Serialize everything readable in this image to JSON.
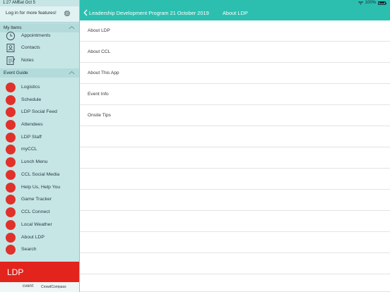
{
  "status_bar": {
    "time": "1:27 AM",
    "date": "Sat Oct 5",
    "battery": "100%"
  },
  "sidebar": {
    "login_label": "Log in for more features!",
    "my_items_header": "My Items",
    "my_items": [
      {
        "label": "Appointments",
        "icon": "clock-icon"
      },
      {
        "label": "Contacts",
        "icon": "contacts-icon"
      },
      {
        "label": "Notes",
        "icon": "notes-icon"
      }
    ],
    "event_guide_header": "Event Guide",
    "event_items": [
      {
        "label": "Logistics",
        "icon": "logistics-icon"
      },
      {
        "label": "Schedule",
        "icon": "calendar-icon"
      },
      {
        "label": "LDP Social Feed",
        "icon": "social-feed-icon"
      },
      {
        "label": "Attendees",
        "icon": "attendees-icon"
      },
      {
        "label": "LDP  Staff",
        "icon": "staff-icon"
      },
      {
        "label": "myCCL",
        "icon": "myccl-icon"
      },
      {
        "label": "Lunch Menu",
        "icon": "lunch-menu-icon"
      },
      {
        "label": "CCL Social Media",
        "icon": "social-media-icon"
      },
      {
        "label": "Help Us, Help You",
        "icon": "feedback-icon"
      },
      {
        "label": "Game Tracker",
        "icon": "game-tracker-icon"
      },
      {
        "label": "CCL Connect",
        "icon": "connect-icon"
      },
      {
        "label": "Local Weather",
        "icon": "weather-icon"
      },
      {
        "label": "About LDP",
        "icon": "info-icon"
      },
      {
        "label": "Search",
        "icon": "search-icon"
      }
    ],
    "banner_text": "LDP",
    "footer_cvent": "cvent",
    "footer_crowdcompass": "CrowdCompass"
  },
  "header": {
    "back_label": "Leadership Development Program 21 October 2019",
    "title": "About LDP"
  },
  "rows": [
    "About LDP",
    "About CCL",
    "About This App",
    "Event Info",
    "Onsite Tips"
  ],
  "colors": {
    "accent": "#2cbfb0",
    "sidebar_bg": "#c6e6e6",
    "brand_red": "#e3241c"
  }
}
